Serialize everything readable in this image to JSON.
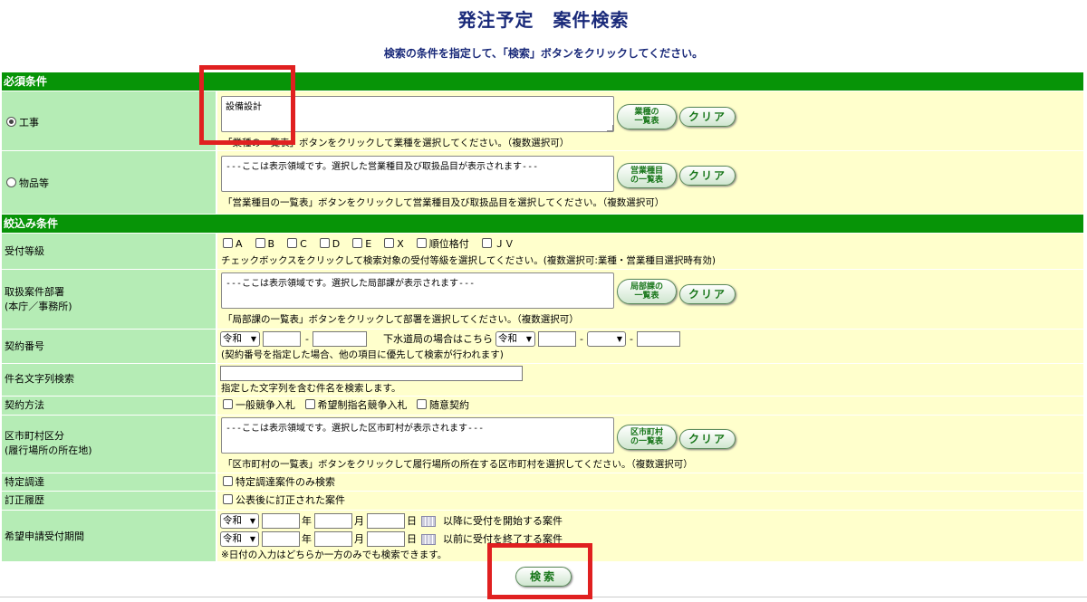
{
  "page": {
    "title": "発注予定　案件検索",
    "subtitle": "検索の条件を指定して、「検索」ボタンをクリックしてください。"
  },
  "sections": {
    "required": "必須条件",
    "filter": "絞込み条件"
  },
  "koji": {
    "label": "工事",
    "selected": true,
    "value": "設備設計",
    "button": "業種の一覧表",
    "clear": "クリア",
    "help": "「業種の一覧表」ボタンをクリックして業種を選択してください。（複数選択可）"
  },
  "buppin": {
    "label": "物品等",
    "selected": false,
    "value": "---ここは表示領域です。選択した営業種目及び取扱品目が表示されます---",
    "button": "営業種目の一覧表",
    "clear": "クリア",
    "help": "「営業種目の一覧表」ボタンをクリックして営業種目及び取扱品目を選択してください。（複数選択可）"
  },
  "grade": {
    "label": "受付等級",
    "options": [
      "A",
      "B",
      "C",
      "D",
      "E",
      "X",
      "順位格付",
      "ＪＶ"
    ],
    "help": "チェックボックスをクリックして検索対象の受付等級を選択してください。(複数選択可:業種・営業種目選択時有効)"
  },
  "dept": {
    "label1": "取扱案件部署",
    "label2": "(本庁／事務所)",
    "value": "---ここは表示領域です。選択した局部課が表示されます---",
    "button": "局部課の一覧表",
    "clear": "クリア",
    "help": "「局部課の一覧表」ボタンをクリックして部署を選択してください。（複数選択可）"
  },
  "contract": {
    "label": "契約番号",
    "era": "令和",
    "sewer_label": "下水道局の場合はこちら",
    "sewer_era": "令和",
    "note": "(契約番号を指定した場合、他の項目に優先して検索が行われます)"
  },
  "keyword": {
    "label": "件名文字列検索",
    "value": "",
    "help": "指定した文字列を含む件名を検索します。"
  },
  "method": {
    "label": "契約方法",
    "options": [
      "一般競争入札",
      "希望制指名競争入札",
      "随意契約"
    ]
  },
  "area": {
    "label1": "区市町村区分",
    "label2": "(履行場所の所在地)",
    "value": "---ここは表示領域です。選択した区市町村が表示されます---",
    "button": "区市町村の一覧表",
    "clear": "クリア",
    "help": "「区市町村の一覧表」ボタンをクリックして履行場所の所在する区市町村を選択してください。（複数選択可）"
  },
  "special": {
    "label": "特定調達",
    "option": "特定調達案件のみ検索"
  },
  "revision": {
    "label": "訂正履歴",
    "option": "公表後に訂正された案件"
  },
  "period": {
    "label": "希望申請受付期間",
    "era": "令和",
    "year": "年",
    "month": "月",
    "day": "日",
    "from_text": "以降に受付を開始する案件",
    "to_text": "以前に受付を終了する案件",
    "note": "※日付の入力はどちらか一方のみでも検索できます。"
  },
  "search_button": "検索"
}
